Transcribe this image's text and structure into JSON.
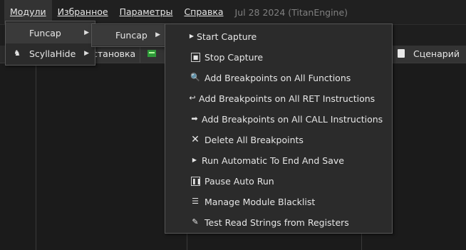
{
  "menubar": {
    "items": [
      "Модули",
      "Избранное",
      "Параметры",
      "Справка"
    ],
    "info": "Jul 28 2024 (TitanEngine)"
  },
  "toolbar": {
    "stop_partial": "становка",
    "script_label": "Сценарий"
  },
  "modules_menu": {
    "items": [
      {
        "label": "Funcap",
        "icon": "none"
      },
      {
        "label": "ScyllaHide",
        "icon": "scyllahide-icon"
      }
    ]
  },
  "funcap_submenu": {
    "items": [
      {
        "label": "Funcap"
      }
    ]
  },
  "funcap_actions": {
    "items": [
      {
        "label": "Start Capture",
        "icon": "play-icon"
      },
      {
        "label": "Stop Capture",
        "icon": "stop-icon"
      },
      {
        "label": "Add Breakpoints on All Functions",
        "icon": "magnifier-icon"
      },
      {
        "label": "Add Breakpoints on All RET Instructions",
        "icon": "return-icon"
      },
      {
        "label": "Add Breakpoints on All CALL Instructions",
        "icon": "call-arrow-icon"
      },
      {
        "label": "Delete All Breakpoints",
        "icon": "x-icon"
      },
      {
        "label": "Run Automatic To End And Save",
        "icon": "run-icon"
      },
      {
        "label": "Pause Auto Run",
        "icon": "pause-icon"
      },
      {
        "label": "Manage Module Blacklist",
        "icon": "list-icon"
      },
      {
        "label": "Test Read Strings from Registers",
        "icon": "edit-icon"
      }
    ]
  }
}
